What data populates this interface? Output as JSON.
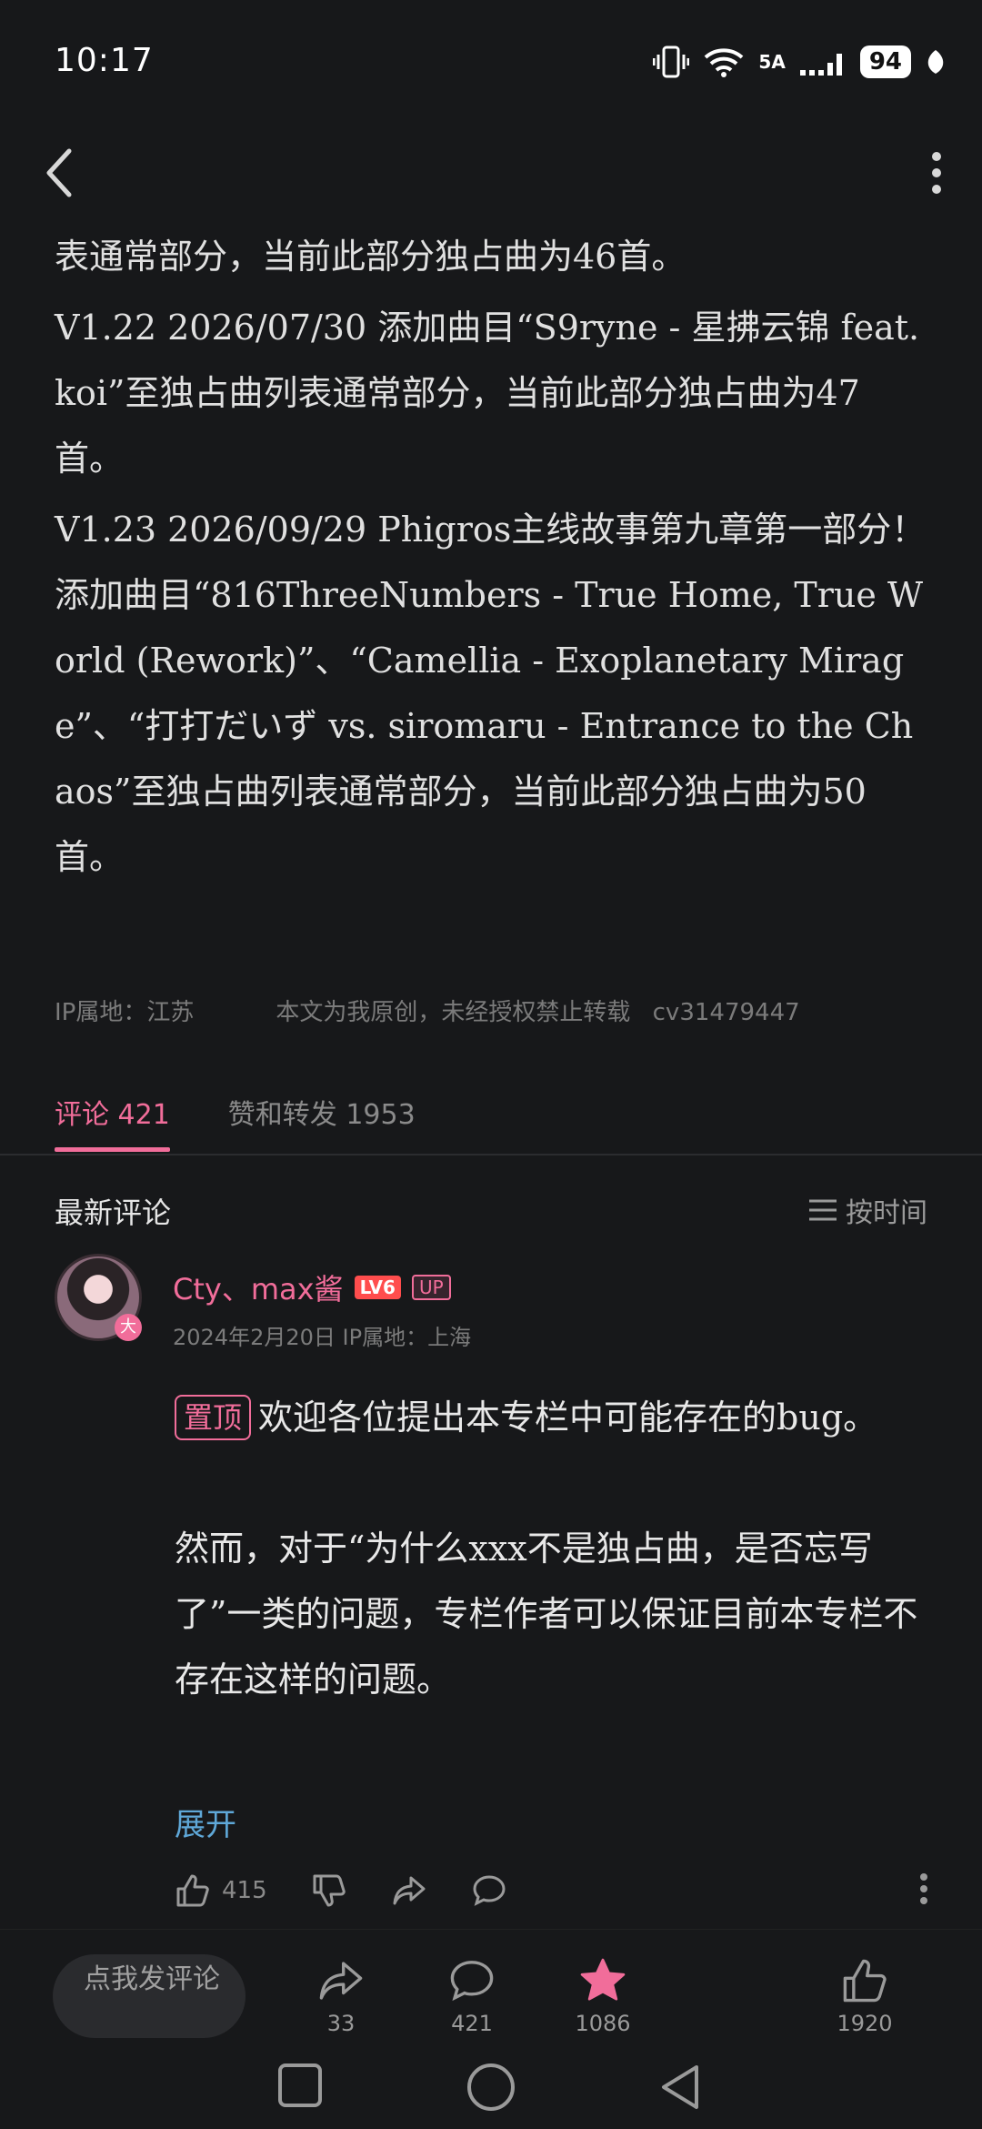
{
  "status": {
    "time": "10:17",
    "network": "5A",
    "battery": "94"
  },
  "article": {
    "paragraphs": [
      "表通常部分，当前此部分独占曲为46首。",
      "V1.22 2026/07/30 添加曲目“S9ryne - 星拂云锦 feat. koi”至独占曲列表通常部分，当前此部分独占曲为47首。",
      "V1.23 2026/09/29 Phigros主线故事第九章第一部分！添加曲目“816ThreeNumbers - True Home, True World (Rework)”、“Camellia - Exoplanetary Mirage”、“打打だいず vs. siromaru - Entrance to the Chaos”至独占曲列表通常部分，当前此部分独占曲为50首。"
    ],
    "ip_location": "IP属地：江苏",
    "copyright": "本文为我原创，未经授权禁止转载",
    "cv_id": "cv31479447"
  },
  "tabs": {
    "comments": "评论 421",
    "likes_reposts": "赞和转发 1953"
  },
  "comments_section": {
    "title": "最新评论",
    "sort_label": "按时间"
  },
  "comment": {
    "username": "Cty、max酱",
    "level": "LV6",
    "up_badge": "UP",
    "avatar_badge": "大",
    "date": "2024年2月20日 IP属地：上海",
    "pin_label": "置顶",
    "text_first": "欢迎各位提出本专栏中可能存在的bug。",
    "text_second": "然而，对于“为什么xxx不是独占曲，是否忘写了”一类的问题，专栏作者可以保证目前本专栏不存在这样的问题。",
    "expand": "展开",
    "like_count": "415"
  },
  "bottom_bar": {
    "input_placeholder": "点我发评论",
    "share_count": "33",
    "comment_count": "421",
    "favorite_count": "1086",
    "like_count": "1920"
  },
  "colors": {
    "accent": "#f16d9a",
    "link": "#5fa8d8",
    "background": "#17181a"
  }
}
